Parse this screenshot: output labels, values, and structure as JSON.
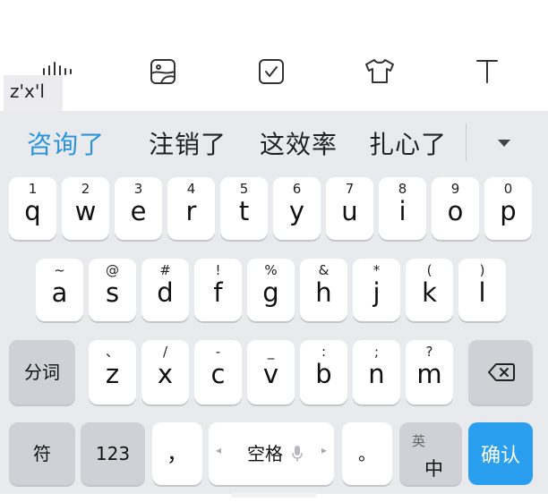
{
  "toolbar": {
    "icons": [
      "voice-wave-icon",
      "sticker-icon",
      "checkbox-icon",
      "tshirt-icon",
      "text-icon"
    ]
  },
  "pinyin": "z'x'l",
  "candidates": [
    "咨询了",
    "注销了",
    "这效率",
    "扎心了"
  ],
  "row1": [
    {
      "sym": "1",
      "ltr": "q"
    },
    {
      "sym": "2",
      "ltr": "w"
    },
    {
      "sym": "3",
      "ltr": "e"
    },
    {
      "sym": "4",
      "ltr": "r"
    },
    {
      "sym": "5",
      "ltr": "t"
    },
    {
      "sym": "6",
      "ltr": "y"
    },
    {
      "sym": "7",
      "ltr": "u"
    },
    {
      "sym": "8",
      "ltr": "i"
    },
    {
      "sym": "9",
      "ltr": "o"
    },
    {
      "sym": "0",
      "ltr": "p"
    }
  ],
  "row2": [
    {
      "sym": "~",
      "ltr": "a"
    },
    {
      "sym": "@",
      "ltr": "s"
    },
    {
      "sym": "#",
      "ltr": "d"
    },
    {
      "sym": "!",
      "ltr": "f"
    },
    {
      "sym": "%",
      "ltr": "g"
    },
    {
      "sym": "&",
      "ltr": "h"
    },
    {
      "sym": "*",
      "ltr": "j"
    },
    {
      "sym": "(",
      "ltr": "k"
    },
    {
      "sym": ")",
      "ltr": "l"
    }
  ],
  "row3": [
    {
      "sym": "、",
      "ltr": "z"
    },
    {
      "sym": "/",
      "ltr": "x"
    },
    {
      "sym": "-",
      "ltr": "c"
    },
    {
      "sym": "_",
      "ltr": "v"
    },
    {
      "sym": ":",
      "ltr": "b"
    },
    {
      "sym": ";",
      "ltr": "n"
    },
    {
      "sym": "?",
      "ltr": "m"
    }
  ],
  "keys": {
    "fenci": "分词",
    "fu": "符",
    "num": "123",
    "comma": "，",
    "space": "空格",
    "period": "。",
    "lang_top": "英",
    "lang_bottom": "中",
    "enter": "确认"
  },
  "colors": {
    "accent": "#2a9ff0",
    "candidate_highlight": "#2b94d9",
    "keyboard_bg": "#e9eaee"
  }
}
